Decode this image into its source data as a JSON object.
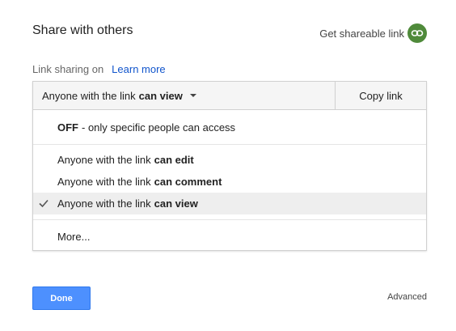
{
  "dialog": {
    "title": "Share with others",
    "get_link_label": "Get shareable link",
    "get_link_icon": "link-icon",
    "accent_color": "#4f8a3a"
  },
  "sharing": {
    "status_label": "Link sharing on",
    "learn_more": "Learn more"
  },
  "selector": {
    "prefix": "Anyone with the link",
    "bold": "can view",
    "icon": "caret-down-icon"
  },
  "copy_link_label": "Copy link",
  "menu": {
    "off": {
      "bold": "OFF",
      "text": "- only specific people can access"
    },
    "can_edit": {
      "text": "Anyone with the link",
      "bold": "can edit"
    },
    "can_comment": {
      "text": "Anyone with the link",
      "bold": "can comment"
    },
    "can_view": {
      "text": "Anyone with the link",
      "bold": "can view",
      "selected": true,
      "icon": "checkmark-icon"
    },
    "more": "More..."
  },
  "footer": {
    "done_label": "Done",
    "done_color": "#4d90fe",
    "advanced_label": "Advanced"
  }
}
